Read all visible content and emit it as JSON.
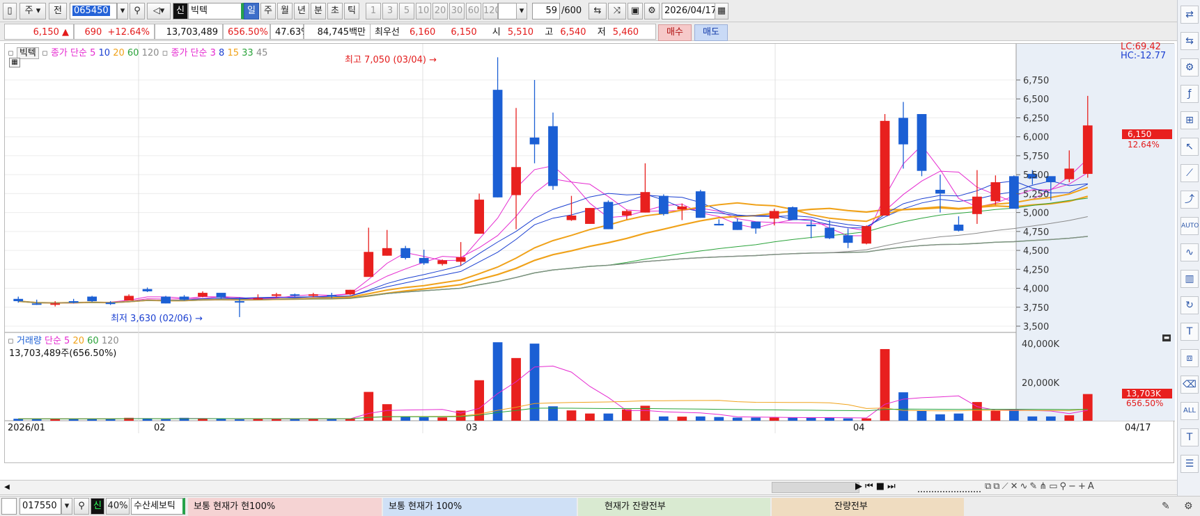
{
  "toolbar": {
    "period_type": "주",
    "prev": "전",
    "code": "065450",
    "sin": "신",
    "name": "빅텍",
    "period_buttons": [
      "일",
      "주",
      "월",
      "년",
      "분",
      "초",
      "틱"
    ],
    "number_buttons": [
      "1",
      "3",
      "5",
      "10",
      "20",
      "30",
      "60",
      "120"
    ],
    "count_current": "59",
    "count_total": "/600",
    "date": "2026/04/17"
  },
  "quote": {
    "price": "6,150",
    "arrow": "▲",
    "change": "690",
    "change_pct": "+12.64%",
    "volume": "13,703,489",
    "volume_ratio": "656.50%",
    "turnover": "47.63%",
    "amount": "84,745백만",
    "best_label": "최우선",
    "best_ask": "6,160",
    "best_bid": "6,150",
    "open_label": "시",
    "open": "5,510",
    "high_label": "고",
    "high": "6,540",
    "low_label": "저",
    "low": "5,460",
    "buy": "매수",
    "sell": "매도"
  },
  "price_panel": {
    "legend_name": "빅텍",
    "legend_ma1_label": "종가 단순",
    "legend_ma1": [
      "5",
      "10",
      "20",
      "60",
      "120"
    ],
    "legend_ma2_label": "종가 단순",
    "legend_ma2": [
      "3",
      "8",
      "15",
      "33",
      "45"
    ],
    "lc": "LC:69.42",
    "hc": "HC:-12.77",
    "high_annotation": "최고 7,050 (03/04)",
    "low_annotation": "최저 3,630 (02/06)",
    "price_badge": "6,150",
    "pct_badge": "12.64%"
  },
  "volume_panel": {
    "legend_name": "거래량",
    "legend_ma_label": "단순",
    "legend_ma": [
      "5",
      "20",
      "60",
      "120"
    ],
    "current": "13,703,489주(656.50%)",
    "badge_value": "13,703K",
    "badge_pct": "656.50%"
  },
  "x_axis": {
    "labels": [
      "2026/01",
      "02",
      "03",
      "04"
    ],
    "end_label": "04/17"
  },
  "bottom_bar": {
    "code": "017550",
    "sin": "신",
    "pct": "40%",
    "name": "수산세보틱",
    "tab1": "보통   현재가   현100%",
    "tab2": "보통   현재가     100%",
    "tab3": "현재가    잔량전부",
    "tab4": "잔량전부"
  },
  "colors": {
    "up": "#e8201e",
    "down": "#1b5fd4",
    "ma5": "#e52ad0",
    "ma10": "#1a3fd1",
    "ma20": "#f0a21a",
    "ma60": "#2aa33a",
    "ma120": "#8a8a8a"
  },
  "chart_data": {
    "type": "candlestick",
    "y_ticks": [
      3500,
      3750,
      4000,
      4250,
      4500,
      4750,
      5000,
      5250,
      5500,
      5750,
      6000,
      6250,
      6500,
      6750
    ],
    "y_tick_labels": [
      "3,500",
      "3,750",
      "4,000",
      "4,250",
      "4,500",
      "4,750",
      "5,000",
      "5,250",
      "5,500",
      "5,750",
      "6,000",
      "6,250",
      "6,500",
      "6,750"
    ],
    "volume_ticks": [
      "20,000K",
      "40,000K"
    ],
    "candles": [
      [
        3860,
        3890,
        3830,
        3810
      ],
      [
        3800,
        3850,
        3790,
        3780
      ],
      [
        3800,
        3830,
        3800,
        3760
      ],
      [
        3830,
        3860,
        3820,
        3800
      ],
      [
        3890,
        3900,
        3830,
        3820
      ],
      [
        3810,
        3830,
        3800,
        3780
      ],
      [
        3840,
        3920,
        3900,
        3840
      ],
      [
        3990,
        4010,
        3960,
        3950
      ],
      [
        3890,
        3900,
        3800,
        3800
      ],
      [
        3890,
        3910,
        3850,
        3840
      ],
      [
        3890,
        3960,
        3940,
        3880
      ],
      [
        3940,
        3920,
        3880,
        3860
      ],
      [
        3830,
        3880,
        3820,
        3620
      ],
      [
        3870,
        3920,
        3870,
        3850
      ],
      [
        3900,
        3940,
        3920,
        3880
      ],
      [
        3920,
        3930,
        3910,
        3890
      ],
      [
        3900,
        3940,
        3920,
        3880
      ],
      [
        3910,
        3940,
        3890,
        3870
      ],
      [
        3920,
        3980,
        3980,
        3910
      ],
      [
        4150,
        4800,
        4480,
        4160
      ],
      [
        4430,
        4770,
        4530,
        4430
      ],
      [
        4530,
        4560,
        4400,
        4380
      ],
      [
        4400,
        4510,
        4330,
        4310
      ],
      [
        4320,
        4380,
        4370,
        4300
      ],
      [
        4350,
        4610,
        4410,
        4300
      ],
      [
        4720,
        5250,
        5170,
        5020
      ],
      [
        6620,
        7050,
        5200,
        5200
      ],
      [
        5230,
        6380,
        5600,
        4780
      ],
      [
        5990,
        6750,
        5900,
        5650
      ],
      [
        6140,
        6320,
        5350,
        5300
      ],
      [
        4900,
        5220,
        4960,
        4890
      ],
      [
        4850,
        5060,
        5060,
        4850
      ],
      [
        5140,
        5160,
        4780,
        4780
      ],
      [
        4960,
        5040,
        5020,
        4910
      ],
      [
        5000,
        5650,
        5270,
        5000
      ],
      [
        5220,
        5240,
        4980,
        4960
      ],
      [
        5040,
        5120,
        5080,
        4900
      ],
      [
        5280,
        5300,
        4930,
        4930
      ],
      [
        4850,
        4910,
        4830,
        4830
      ],
      [
        4880,
        4920,
        4770,
        4770
      ],
      [
        4880,
        4860,
        4790,
        4720
      ],
      [
        4920,
        5050,
        5020,
        4830
      ],
      [
        5070,
        5080,
        4900,
        4900
      ],
      [
        4840,
        4900,
        4820,
        4660
      ],
      [
        4800,
        4900,
        4660,
        4650
      ],
      [
        4700,
        4790,
        4600,
        4530
      ],
      [
        4590,
        4830,
        4820,
        4580
      ],
      [
        4960,
        6300,
        6210,
        4960
      ],
      [
        6250,
        6460,
        5900,
        5580
      ],
      [
        6300,
        6300,
        5550,
        5480
      ],
      [
        5300,
        5500,
        5250,
        5000
      ],
      [
        4840,
        4950,
        4760,
        4750
      ],
      [
        4980,
        5560,
        5210,
        4850
      ],
      [
        5150,
        5490,
        5400,
        5100
      ],
      [
        5480,
        5490,
        5050,
        5060
      ],
      [
        5510,
        5560,
        5450,
        5370
      ],
      [
        5480,
        5440,
        5400,
        5160
      ],
      [
        5440,
        5820,
        5580,
        5400
      ],
      [
        5510,
        6540,
        6150,
        5460
      ]
    ],
    "volumes": [
      1,
      1,
      1,
      1,
      1,
      1,
      1.5,
      1,
      0.8,
      1.5,
      1,
      1,
      0.7,
      1,
      1,
      1,
      1,
      1,
      1,
      14.8,
      8.5,
      2.2,
      1.8,
      1.7,
      5.2,
      20.8,
      40.3,
      32.2,
      39.6,
      7.4,
      5.3,
      3.7,
      3.7,
      5.8,
      7.7,
      2.2,
      2.1,
      2.2,
      1.9,
      1.6,
      1.6,
      1.6,
      1.6,
      1.6,
      1.6,
      1.2,
      1.2,
      36.8,
      14.6,
      5.3,
      3.3,
      3.7,
      9.6,
      5.1,
      5.9,
      2.2,
      2.2,
      2.8,
      13.7
    ]
  }
}
